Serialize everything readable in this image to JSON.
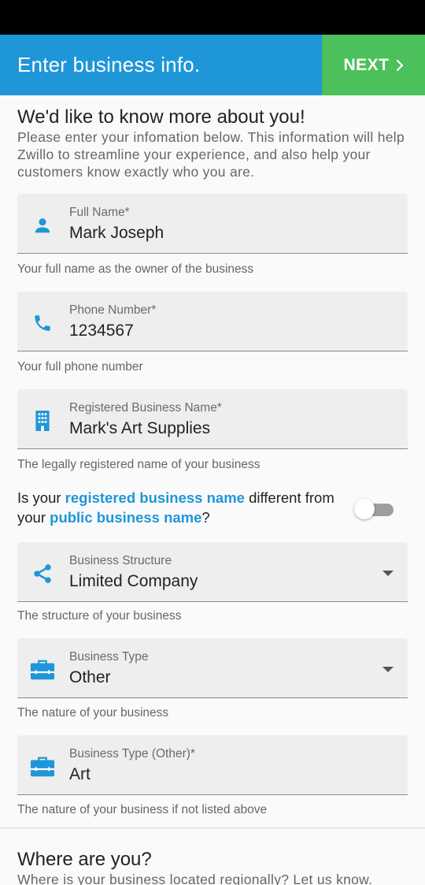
{
  "app_bar": {
    "title": "Enter business info.",
    "next_label": "NEXT",
    "colors": {
      "primary": "#1f96d8",
      "next": "#4cc05a"
    }
  },
  "intro": {
    "heading": "We'd like to know more about you!",
    "text": "Please enter your infomation below. This information will help Zwillo to streamline your experience, and also help your customers know exactly who you are."
  },
  "fields": {
    "full_name": {
      "label": "Full Name*",
      "value": "Mark Joseph",
      "helper": "Your full name as the owner of the business",
      "icon": "person-icon"
    },
    "phone": {
      "label": "Phone Number*",
      "value": "1234567",
      "helper": "Your full phone number",
      "icon": "phone-icon"
    },
    "registered_name": {
      "label": "Registered Business Name*",
      "value": "Mark's Art Supplies",
      "helper": "The legally registered name of your business",
      "icon": "building-icon"
    },
    "structure": {
      "label": "Business Structure",
      "value": "Limited Company",
      "helper": "The structure of your business",
      "icon": "share-icon"
    },
    "type": {
      "label": "Business Type",
      "value": "Other",
      "helper": "The nature of your business",
      "icon": "briefcase-icon"
    },
    "type_other": {
      "label": "Business Type (Other)*",
      "value": "Art",
      "helper": "The nature of your business if not listed above",
      "icon": "briefcase-icon"
    }
  },
  "question": {
    "part1": "Is your ",
    "highlight1": "registered business name",
    "part2": " different from your ",
    "highlight2": "public business name",
    "part3": "?",
    "toggle_on": false
  },
  "location": {
    "heading": "Where are you?",
    "text": "Where is your business located regionally? Let us know."
  }
}
